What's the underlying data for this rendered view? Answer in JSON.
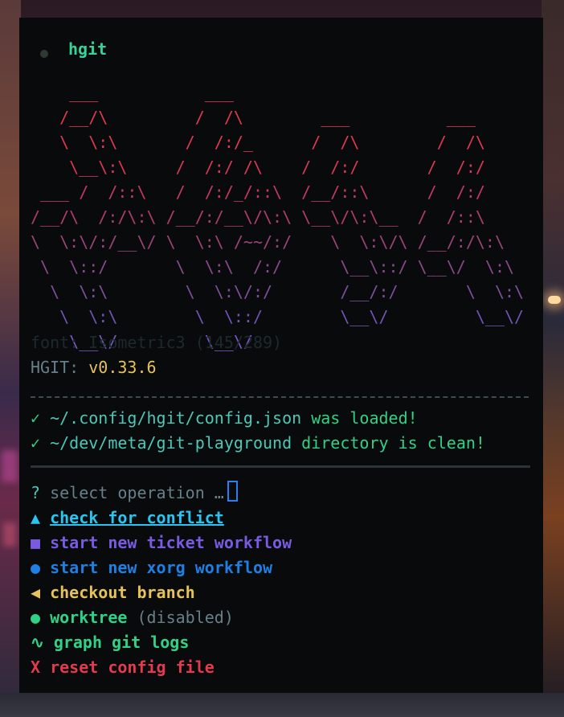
{
  "window": {
    "title": "hgit"
  },
  "banner": {
    "lines": [
      "    ___           ___",
      "   /__/\\         /  /\\        ___          ___",
      "   \\  \\:\\       /  /:/_      /  /\\        /  /\\",
      "    \\__\\:\\     /  /:/ /\\    /  /:/       /  /:/",
      " ___ /  /::\\   /  /:/_/::\\  /__/::\\      /  /:/",
      "/__/\\  /:/\\:\\ /__/:/__\\/\\:\\ \\__\\/\\:\\__  /  /::\\",
      "\\  \\:\\/:/__\\/ \\  \\:\\ /~~/:/    \\  \\:\\/\\ /__/:/\\:\\",
      " \\  \\::/       \\  \\:\\  /:/      \\__\\::/ \\__\\/  \\:\\",
      "  \\  \\:\\        \\  \\:\\/:/       /__/:/       \\  \\:\\",
      "   \\  \\:\\        \\  \\::/        \\__\\/         \\__\\/",
      "    \\__\\/         \\__\\/"
    ],
    "font_info": "font: Isometric3 (145/289)",
    "version_label": "HGIT:",
    "version": "v0.33.6"
  },
  "status": [
    {
      "icon": "✓",
      "path": "~/.config/hgit/config.json",
      "text": "was loaded!"
    },
    {
      "icon": "✓",
      "path": "~/dev/meta/git-playground",
      "text": "directory is clean!"
    }
  ],
  "prompt": {
    "symbol": "?",
    "text": "select operation …"
  },
  "menu": [
    {
      "icon": "▲",
      "label": "check for conflict",
      "note": ""
    },
    {
      "icon": "■",
      "label": "start new ticket workflow",
      "note": ""
    },
    {
      "icon": "●",
      "label": "start new xorg workflow",
      "note": ""
    },
    {
      "icon": "◀",
      "label": "checkout branch",
      "note": ""
    },
    {
      "icon": "●",
      "label": "worktree",
      "note": "(disabled)"
    },
    {
      "icon": "∿",
      "label": "graph git logs",
      "note": ""
    },
    {
      "icon": "X",
      "label": "reset config file",
      "note": ""
    }
  ],
  "colors": {
    "banner_top": "#e0394e",
    "banner_bottom": "#7a57c8",
    "check": "#2fd287",
    "path": "#4bc8b8",
    "selected": "#2bc4f0",
    "ticket": "#7a5ae0",
    "xorg": "#1f7fe3",
    "checkout": "#e6c25a",
    "worktree": "#2fd287",
    "graph": "#2fd287",
    "reset": "#e23b4c"
  }
}
